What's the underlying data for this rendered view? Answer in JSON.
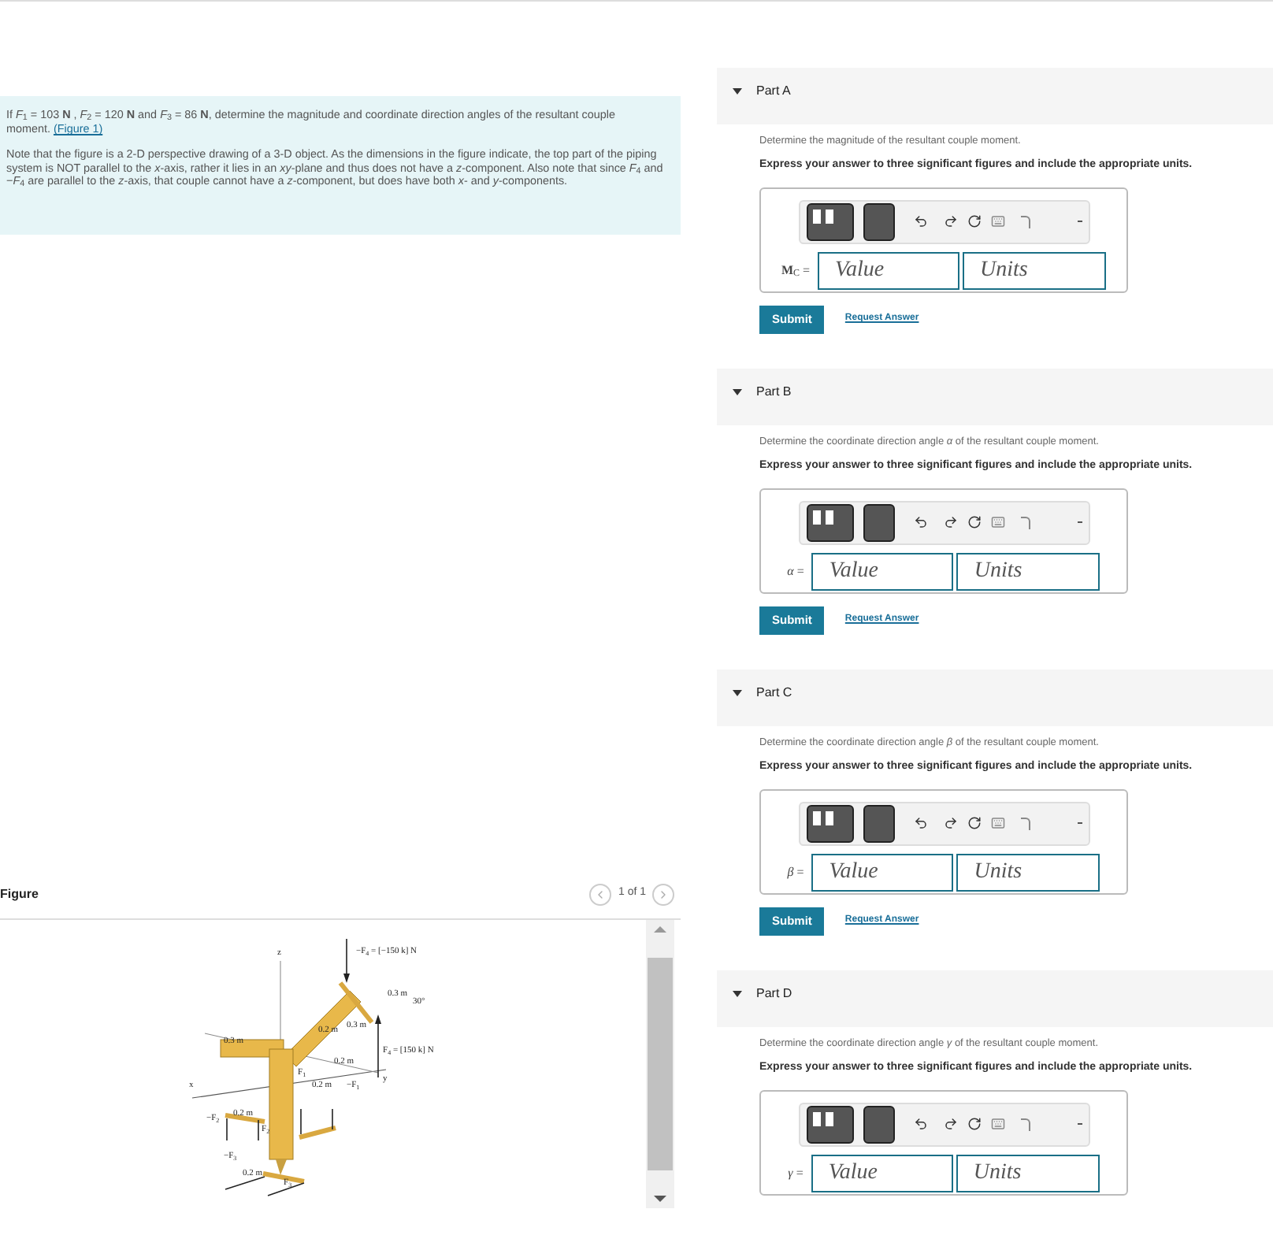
{
  "problem": {
    "statement": "If *F*$_{1}$ = 103 **N** , *F*$_{2}$ = 120 **N** and *F*$_{3}$ = 86 **N**, determine the magnitude and coordinate direction angles of the resultant couple moment.",
    "figure_link": "(Figure 1)",
    "note": "Note that the figure is a 2-D perspective drawing of a 3-D object. As the dimensions in the figure indicate, the top part of the piping system is NOT parallel to the *x*-axis, rather it lies in an *xy*-plane and thus does not have a *z*-component. Also note that since *F*$_{4}$ and −*F*$_{4}$ are parallel to the *z*-axis, that couple cannot have a *z*-component, but does have both *x*- and *y*-components."
  },
  "figure": {
    "title": "Figure",
    "pager": "1 of 1",
    "labels": [
      "z",
      "−F$_{4}$ = [−150 k] N",
      "0.3 m",
      "30°",
      "0.3 m",
      "0.2 m",
      "0.3 m",
      "F$_{4}$ = [150 k] N",
      "0.2 m",
      "x",
      "F$_{1}$",
      "0.2 m",
      "−F$_{1}$",
      "y",
      "−F$_{2}$",
      "0.2 m",
      "F$_{2}$",
      "−F$_{3}$",
      "0.2 m",
      "F$_{3}$"
    ]
  },
  "parts": [
    {
      "label": "Part A",
      "expanded": true,
      "prompt": "Determine the magnitude of the resultant couple moment.",
      "instruction": "Express your answer to three significant figures and include the appropriate units.",
      "variable": "**M**$_{C}$ =",
      "value_placeholder": "Value",
      "units_placeholder": "Units",
      "submit": "Submit",
      "request": "Request Answer"
    },
    {
      "label": "Part B",
      "expanded": true,
      "prompt": "Determine the coordinate direction angle *α* of the resultant couple moment.",
      "instruction": "Express your answer to three significant figures and include the appropriate units.",
      "variable": "*α* =",
      "value_placeholder": "Value",
      "units_placeholder": "Units",
      "submit": "Submit",
      "request": "Request Answer"
    },
    {
      "label": "Part C",
      "expanded": true,
      "prompt": "Determine the coordinate direction angle *β* of the resultant couple moment.",
      "instruction": "Express your answer to three significant figures and include the appropriate units.",
      "variable": "*β* =",
      "value_placeholder": "Value",
      "units_placeholder": "Units",
      "submit": "Submit",
      "request": "Request Answer"
    },
    {
      "label": "Part D",
      "expanded": true,
      "prompt": "Determine the coordinate direction angle *γ* of the resultant couple moment.",
      "instruction": "Express your answer to three significant figures and include the appropriate units.",
      "variable": "*γ* =",
      "value_placeholder": "Value",
      "units_placeholder": "Units"
    }
  ]
}
